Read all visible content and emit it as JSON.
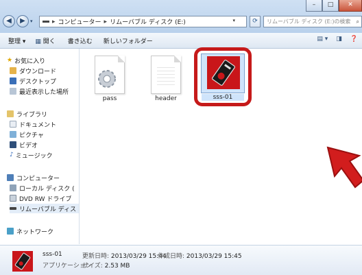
{
  "window": {
    "controls": {
      "minimize": "–",
      "maximize": "□",
      "close": "✕"
    }
  },
  "address_bar": {
    "crumbs": [
      "コンピューター",
      "リムーバブル ディスク (E:)"
    ],
    "separator": "▸"
  },
  "search": {
    "placeholder": "リムーバブル ディスク (E:)の検索"
  },
  "toolbar": {
    "organize": "整理 ▾",
    "open": "開く",
    "burn": "書き込む",
    "new_folder": "新しいフォルダー"
  },
  "nav": {
    "favorites": "お気に入り",
    "downloads": "ダウンロード",
    "desktop": "デスクトップ",
    "recent": "最近表示した場所",
    "libraries": "ライブラリ",
    "documents": "ドキュメント",
    "pictures": "ピクチャ",
    "videos": "ビデオ",
    "music": "ミュージック",
    "computer": "コンピューター",
    "local_disk": "ローカル ディスク (",
    "dvd": "DVD RW ドライブ",
    "removable": "リムーバブル ディス",
    "network": "ネットワーク"
  },
  "files": [
    {
      "name": "pass",
      "icon": "gear-document-icon"
    },
    {
      "name": "header",
      "icon": "document-icon"
    },
    {
      "name": "sss-01",
      "icon": "app-icon",
      "selected": true
    }
  ],
  "details": {
    "name": "sss-01",
    "type": "アプリケーション",
    "modified_label": "更新日時:",
    "modified": "2013/03/29 15:44",
    "created_label": "作成日時:",
    "created": "2013/03/29 15:45",
    "size_label": "サイズ:",
    "size": "2.53 MB"
  },
  "colors": {
    "highlight_frame": "#c61a1a",
    "selection": "#cfe4fb",
    "app_background": "#c9161a"
  }
}
